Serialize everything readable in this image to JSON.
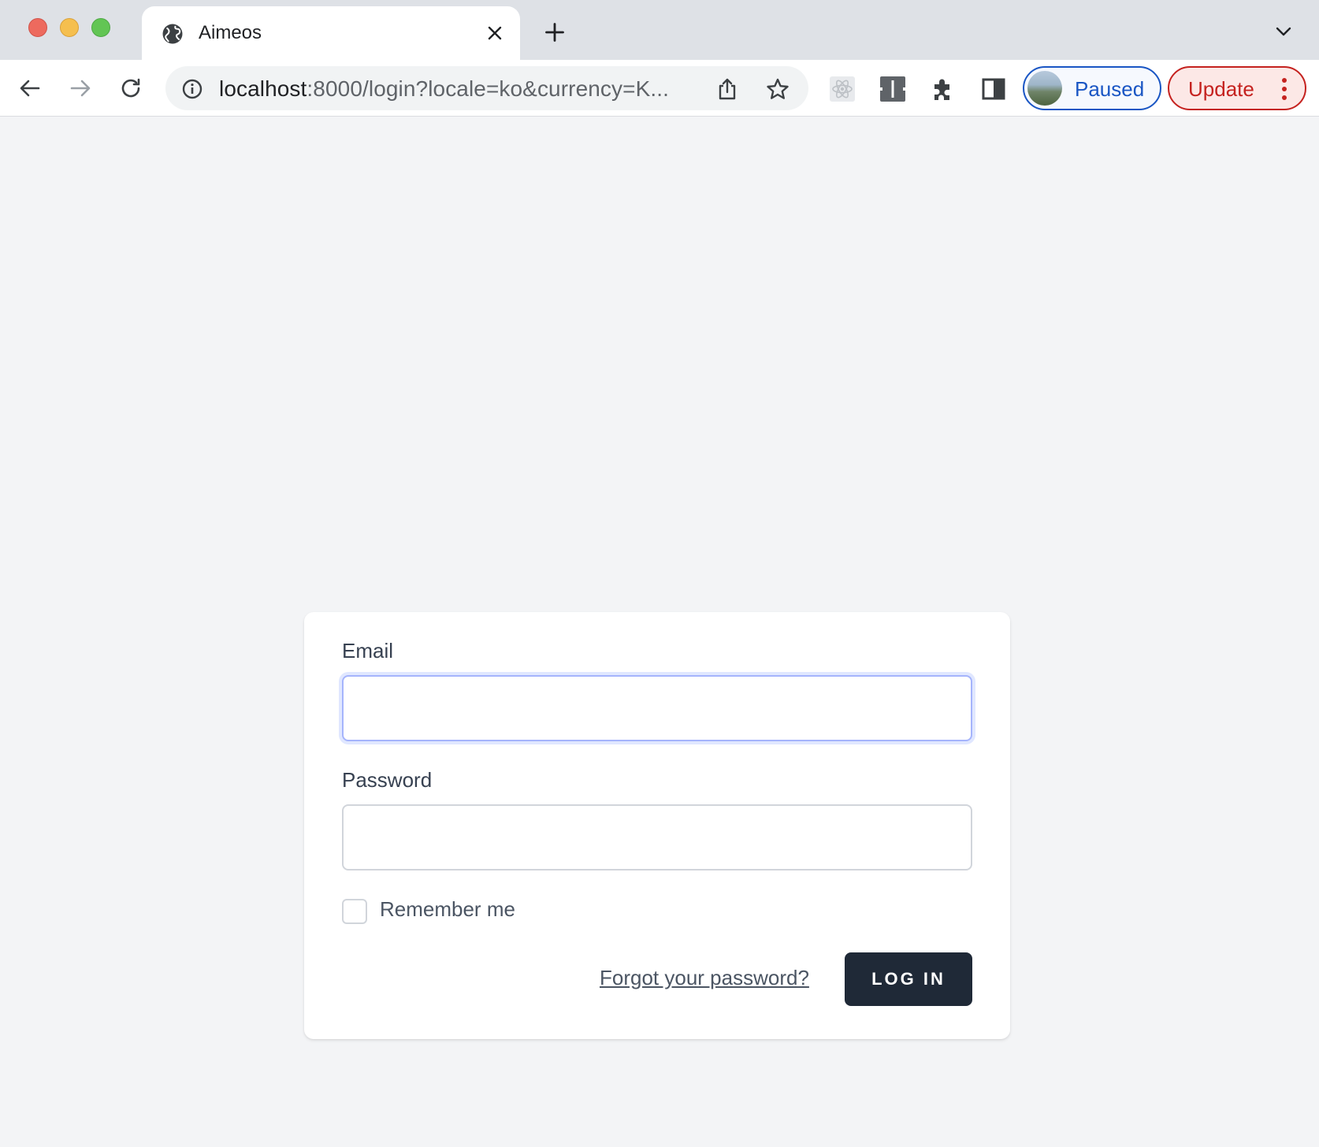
{
  "browser": {
    "tab": {
      "title": "Aimeos",
      "icon": "globe-icon"
    },
    "address": {
      "host": "localhost",
      "rest": ":8000/login?locale=ko&currency=K..."
    },
    "profile": {
      "label": "Paused"
    },
    "update": {
      "label": "Update"
    },
    "colors": {
      "paused": "#1a56c4",
      "update": "#c5221f"
    }
  },
  "login": {
    "email_label": "Email",
    "email_value": "",
    "password_label": "Password",
    "password_value": "",
    "remember_label": "Remember me",
    "remember_checked": false,
    "forgot_link": "Forgot your password?",
    "submit_label": "LOG IN"
  },
  "colors": {
    "page_bg": "#f3f4f6",
    "button_bg": "#1f2937",
    "focus_ring": "#a5b4fc"
  }
}
